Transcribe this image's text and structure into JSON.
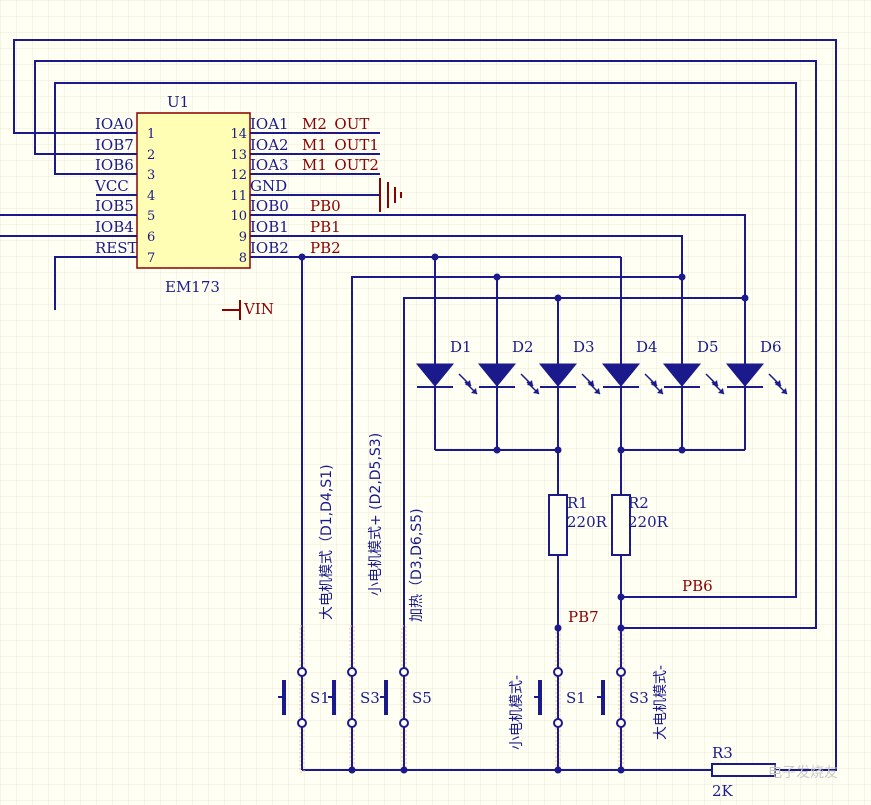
{
  "chip": {
    "designator": "U1",
    "part": "EM173",
    "left_pins": [
      {
        "name": "IOA0",
        "num": "1"
      },
      {
        "name": "IOB7",
        "num": "2"
      },
      {
        "name": "IOB6",
        "num": "3"
      },
      {
        "name": "VCC",
        "num": "4"
      },
      {
        "name": "IOB5",
        "num": "5"
      },
      {
        "name": "IOB4",
        "num": "6"
      },
      {
        "name": "REST",
        "num": "7"
      }
    ],
    "right_pins": [
      {
        "name": "IOA1",
        "num": "14"
      },
      {
        "name": "IOA2",
        "num": "13"
      },
      {
        "name": "IOA3",
        "num": "12"
      },
      {
        "name": "GND",
        "num": "11"
      },
      {
        "name": "IOB0",
        "num": "10"
      },
      {
        "name": "IOB1",
        "num": "9"
      },
      {
        "name": "IOB2",
        "num": "8"
      }
    ]
  },
  "nets": {
    "m2_out": "M2_OUT",
    "m1_out1": "M1_OUT1",
    "m1_out2": "M1_OUT2",
    "pb0": "PB0",
    "pb1": "PB1",
    "pb2": "PB2",
    "pb6": "PB6",
    "pb7": "PB7",
    "vin": "VIN"
  },
  "leds": [
    "D1",
    "D2",
    "D3",
    "D4",
    "D5",
    "D6"
  ],
  "resistors": [
    {
      "name": "R1",
      "value": "220R"
    },
    {
      "name": "R2",
      "value": "220R"
    },
    {
      "name": "R3",
      "value": "2K"
    }
  ],
  "switches": {
    "left": [
      "S1",
      "S3",
      "S5"
    ],
    "right": [
      "S1",
      "S3"
    ]
  },
  "switch_labels": {
    "big_motor": "大电机模式（D1,D4,S1)",
    "small_motor_plus": "小电机模式+ (D2,D5,S3)",
    "heating": "加热（D3,D6,S5)",
    "small_motor_minus": "小电机模式-",
    "big_motor_minus": "大电机模式-"
  },
  "watermark": "电子发烧友"
}
